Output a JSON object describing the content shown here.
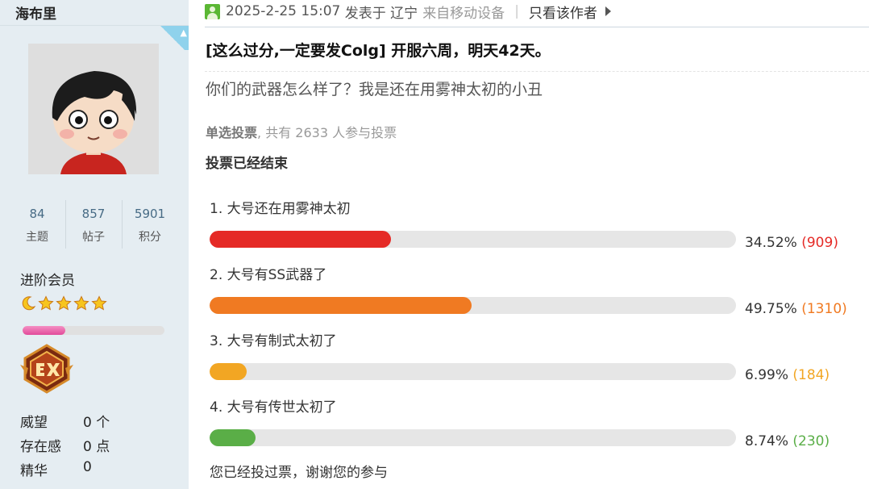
{
  "profile": {
    "username": "海布里",
    "stats": [
      {
        "value": "84",
        "label": "主题"
      },
      {
        "value": "857",
        "label": "帖子"
      },
      {
        "value": "5901",
        "label": "积分"
      }
    ],
    "rank": "进阶会员",
    "level_progress": 0.3,
    "meta": [
      {
        "label": "威望",
        "value": "0 个"
      },
      {
        "label": "存在感",
        "value": "0 点"
      },
      {
        "label": "精华",
        "value": "0"
      }
    ]
  },
  "post": {
    "timestamp": "2025-2-25 15:07",
    "posted_in": "发表于 辽宁",
    "device": "来自移动设备",
    "author_only": "只看该作者",
    "title": "[这么过分,一定要发Colg] 开服六周，明天42天。",
    "body": "你们的武器怎么样了？我是还在用雾神太初的小丑"
  },
  "poll": {
    "type": "单选投票",
    "participants": ", 共有 2633 人参与投票",
    "status": "投票已经结束",
    "voted_note": "您已经投过票，谢谢您的参与",
    "options": [
      {
        "label": "1.  大号还在用雾神太初",
        "percent": "34.52%",
        "count": "(909)",
        "fraction": 0.3452,
        "color": "#e52a26"
      },
      {
        "label": "2.  大号有SS武器了",
        "percent": "49.75%",
        "count": "(1310)",
        "fraction": 0.4975,
        "color": "#f07a22"
      },
      {
        "label": "3.  大号有制式太初了",
        "percent": "6.99%",
        "count": "(184)",
        "fraction": 0.0699,
        "color": "#f2a623"
      },
      {
        "label": "4.  大号有传世太初了",
        "percent": "8.74%",
        "count": "(230)",
        "fraction": 0.0874,
        "color": "#5aae47"
      }
    ]
  }
}
